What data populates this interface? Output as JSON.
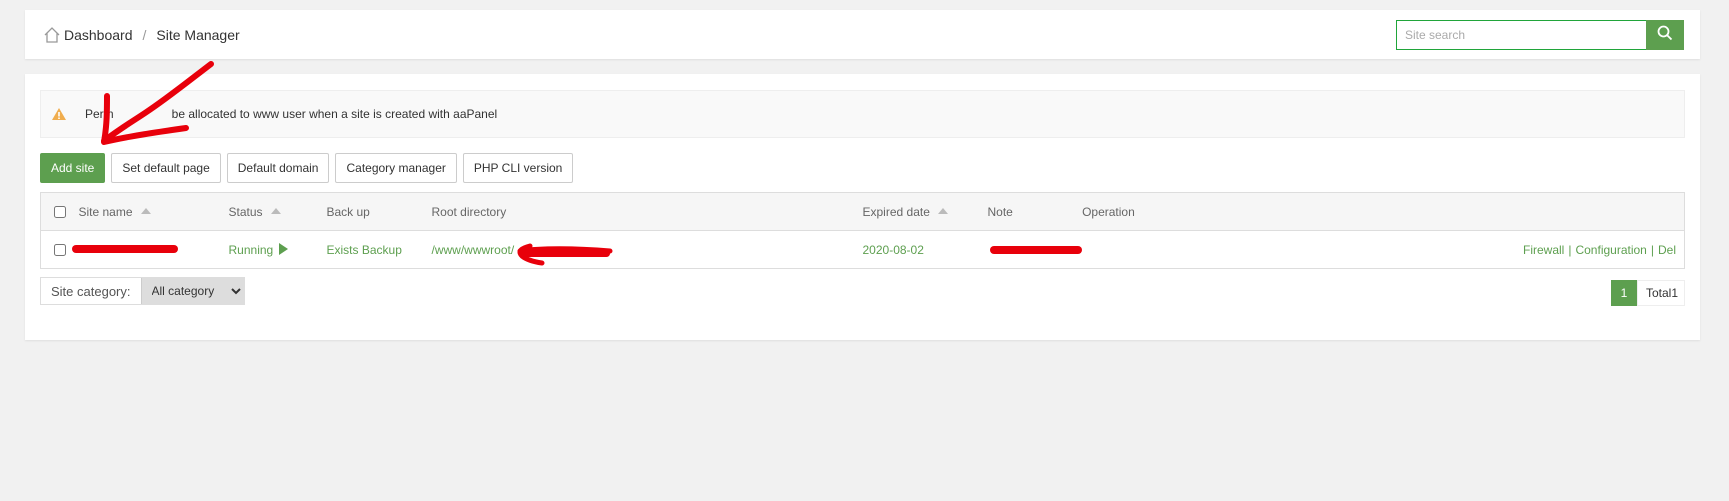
{
  "header": {
    "breadcrumb": {
      "home_icon": "home-icon",
      "dashboard": "Dashboard",
      "separator": "/",
      "current": "Site Manager"
    },
    "search": {
      "placeholder": "Site search",
      "icon": "search-icon"
    }
  },
  "alert": {
    "icon": "warning-icon",
    "text_before": "Perm",
    "text_after": "be allocated to www user when a site is created with aaPanel"
  },
  "toolbar": {
    "add_site": "Add site",
    "set_default_page": "Set default page",
    "default_domain": "Default domain",
    "category_manager": "Category manager",
    "php_cli_version": "PHP CLI version"
  },
  "table": {
    "headers": {
      "site_name": "Site name",
      "status": "Status",
      "backup": "Back up",
      "root_directory": "Root directory",
      "expired_date": "Expired date",
      "note": "Note",
      "operation": "Operation"
    },
    "rows": [
      {
        "status": "Running",
        "backup": "Exists Backup",
        "root_directory": "/www/wwwroot/",
        "expired_date": "2020-08-02",
        "ops": {
          "firewall": "Firewall",
          "configuration": "Configuration",
          "del": "Del",
          "sep": "|"
        }
      }
    ]
  },
  "footer": {
    "category_label": "Site category:",
    "category_selected": "All category",
    "page_current": "1",
    "total": "Total1"
  },
  "colors": {
    "accent": "#5d9f4f",
    "annotation": "#e8000b",
    "warning": "#f0ad4e"
  }
}
